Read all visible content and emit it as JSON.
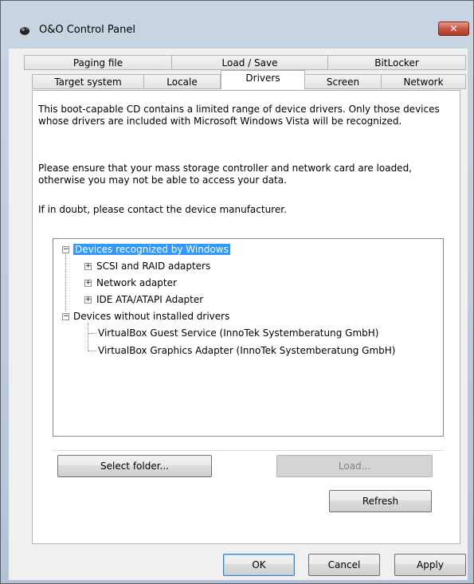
{
  "window": {
    "title": "O&O Control Panel",
    "close_glyph": "✕"
  },
  "tabs": {
    "row1": [
      "Paging file",
      "Load / Save",
      "BitLocker"
    ],
    "row2": [
      "Target system",
      "Locale",
      "Drivers",
      "Screen",
      "Network"
    ]
  },
  "content": {
    "para1": "This boot-capable CD contains a limited range of device drivers. Only those devices whose drivers are included with Microsoft Windows Vista will be recognized.",
    "para2": "Please ensure that your mass storage controller and network card are loaded, otherwise you may not be able to access your data.",
    "para3": "If in doubt, please contact the device manufacturer."
  },
  "tree": {
    "nodes": [
      {
        "label": "Devices recognized by Windows",
        "selected": true,
        "expander": "−"
      },
      {
        "label": "SCSI and RAID adapters",
        "expander": "+"
      },
      {
        "label": "Network adapter",
        "expander": "+"
      },
      {
        "label": "IDE ATA/ATAPI Adapter",
        "expander": "+"
      },
      {
        "label": "Devices without installed drivers",
        "expander": "−"
      },
      {
        "label": "VirtualBox Guest Service (InnoTek Systemberatung GmbH)"
      },
      {
        "label": "VirtualBox Graphics Adapter (InnoTek Systemberatung GmbH)"
      }
    ]
  },
  "buttons": {
    "select_folder": "Select folder...",
    "load": "Load...",
    "refresh": "Refresh",
    "ok": "OK",
    "cancel": "Cancel",
    "apply": "Apply"
  },
  "colors": {
    "selection": "#3399ff",
    "close": "#c5523f"
  }
}
